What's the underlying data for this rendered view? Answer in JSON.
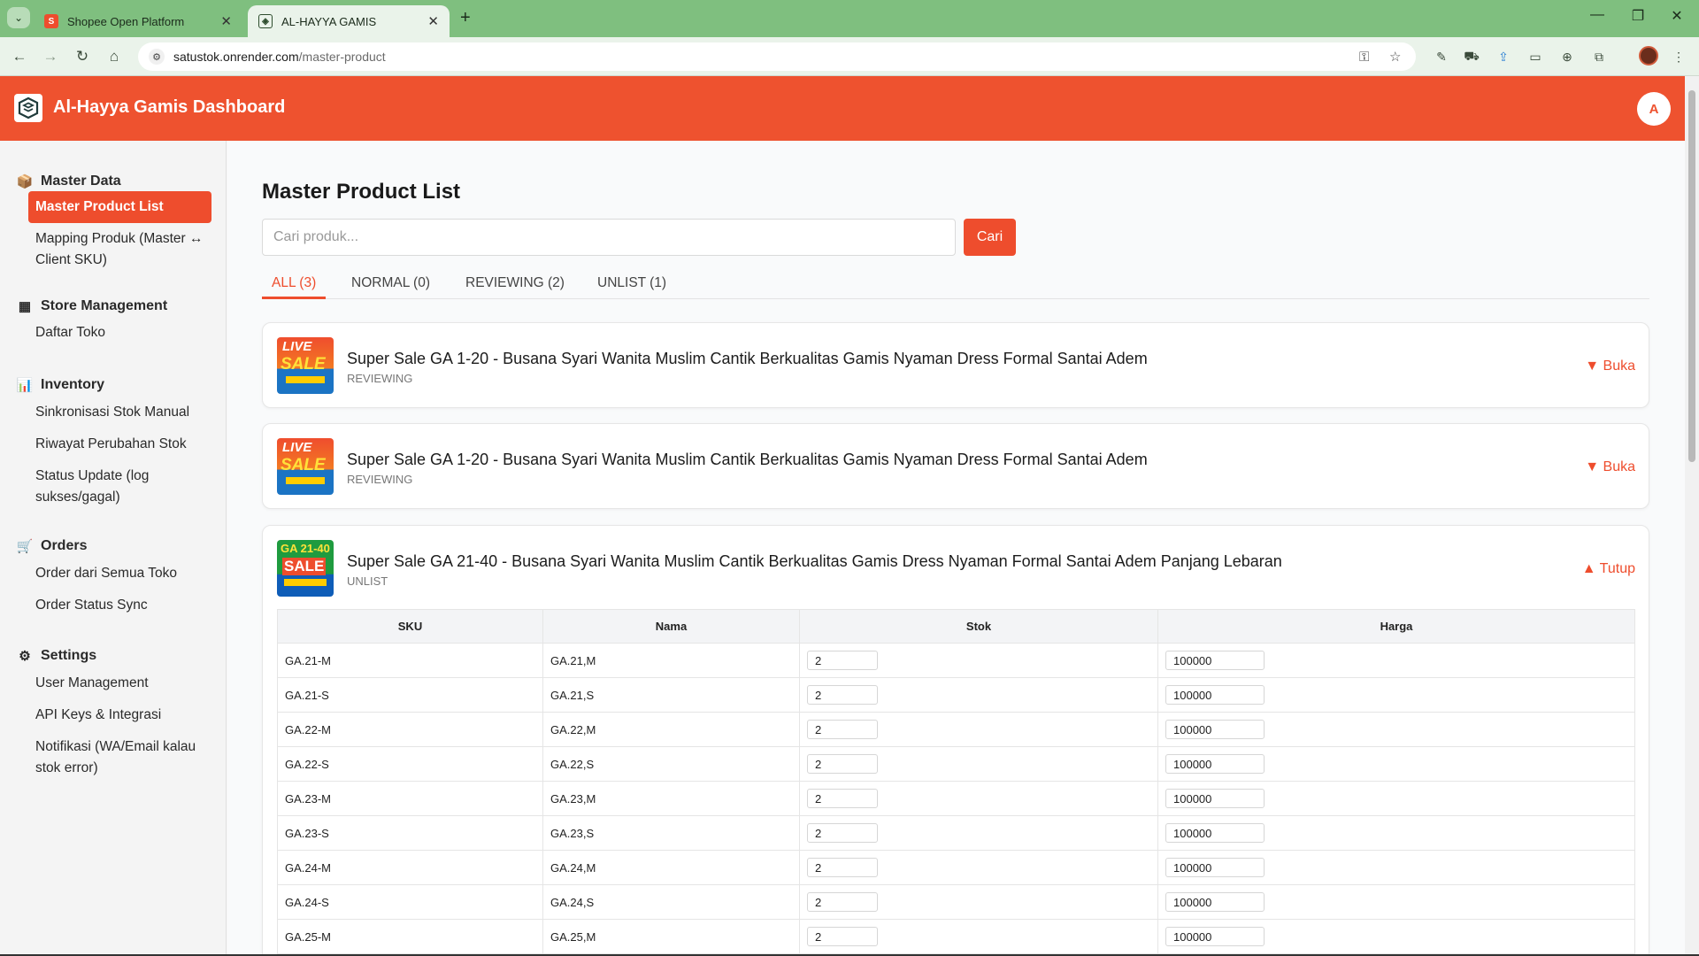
{
  "browser": {
    "tabs": [
      {
        "title": "Shopee Open Platform"
      },
      {
        "title": "AL-HAYYA GAMIS"
      }
    ],
    "address": {
      "host": "satustok.onrender.com",
      "path": "/master-product"
    }
  },
  "header": {
    "title": "Al-Hayya Gamis Dashboard",
    "avatar_letter": "A"
  },
  "sidebar": {
    "sections": [
      {
        "title": "Master Data",
        "icon": "box-icon",
        "items": [
          "Master Product List",
          "Mapping Produk (Master ↔ Client SKU)"
        ]
      },
      {
        "title": "Store Management",
        "icon": "store-icon",
        "items": [
          "Daftar Toko"
        ]
      },
      {
        "title": "Inventory",
        "icon": "chart-icon",
        "items": [
          "Sinkronisasi Stok Manual",
          "Riwayat Perubahan Stok",
          "Status Update (log sukses/gagal)"
        ]
      },
      {
        "title": "Orders",
        "icon": "cart-icon",
        "items": [
          "Order dari Semua Toko",
          "Order Status Sync"
        ]
      },
      {
        "title": "Settings",
        "icon": "gear-icon",
        "items": [
          "User Management",
          "API Keys & Integrasi",
          "Notifikasi (WA/Email kalau stok error)"
        ]
      }
    ],
    "active_item": "Master Product List"
  },
  "main": {
    "title": "Master Product List",
    "search": {
      "placeholder": "Cari produk...",
      "value": "",
      "button": "Cari"
    },
    "tabs": [
      "ALL (3)",
      "NORMAL (0)",
      "REVIEWING (2)",
      "UNLIST (1)"
    ],
    "active_tab": "ALL (3)",
    "products": [
      {
        "name": "Super Sale GA 1-20 - Busana Syari Wanita Muslim Cantik Berkualitas Gamis Nyaman Dress Formal Santai Adem",
        "status": "REVIEWING",
        "toggle": "▼ Buka",
        "image_text": [
          "LIVE",
          "SALE"
        ]
      },
      {
        "name": "Super Sale GA 1-20 - Busana Syari Wanita Muslim Cantik Berkualitas Gamis Nyaman Dress Formal Santai Adem",
        "status": "REVIEWING",
        "toggle": "▼ Buka",
        "image_text": [
          "LIVE",
          "SALE"
        ]
      },
      {
        "name": "Super Sale GA 21-40 - Busana Syari Wanita Muslim Cantik Berkualitas Gamis Dress Nyaman Formal Santai Adem Panjang Lebaran",
        "status": "UNLIST",
        "toggle": "▲ Tutup",
        "image_text": [
          "GA 21-40",
          "SALE"
        ]
      }
    ],
    "table": {
      "headers": [
        "SKU",
        "Nama",
        "Stok",
        "Harga"
      ],
      "rows": [
        {
          "sku": "GA.21-M",
          "nama": "GA.21,M",
          "stok": "2",
          "harga": "100000"
        },
        {
          "sku": "GA.21-S",
          "nama": "GA.21,S",
          "stok": "2",
          "harga": "100000"
        },
        {
          "sku": "GA.22-M",
          "nama": "GA.22,M",
          "stok": "2",
          "harga": "100000"
        },
        {
          "sku": "GA.22-S",
          "nama": "GA.22,S",
          "stok": "2",
          "harga": "100000"
        },
        {
          "sku": "GA.23-M",
          "nama": "GA.23,M",
          "stok": "2",
          "harga": "100000"
        },
        {
          "sku": "GA.23-S",
          "nama": "GA.23,S",
          "stok": "2",
          "harga": "100000"
        },
        {
          "sku": "GA.24-M",
          "nama": "GA.24,M",
          "stok": "2",
          "harga": "100000"
        },
        {
          "sku": "GA.24-S",
          "nama": "GA.24,S",
          "stok": "2",
          "harga": "100000"
        },
        {
          "sku": "GA.25-M",
          "nama": "GA.25,M",
          "stok": "2",
          "harga": "100000"
        }
      ]
    }
  },
  "colors": {
    "brand": "#ee4d2d",
    "header": "#ee522f",
    "browser_frame": "#7fbf7f"
  }
}
